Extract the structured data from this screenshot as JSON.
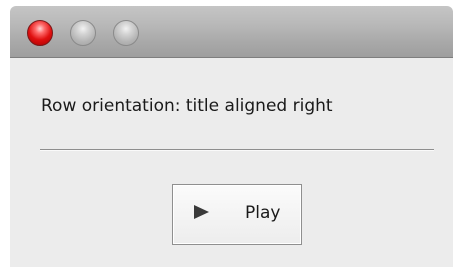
{
  "window": {
    "controls": {
      "close_icon": "close-traffic-light",
      "minimize_icon": "minimize-traffic-light",
      "zoom_icon": "zoom-traffic-light",
      "close_color": "#e01010",
      "inactive_color": "#b4b4b4"
    }
  },
  "content": {
    "heading": "Row orientation: title aligned right",
    "play_button": {
      "icon": "play-icon",
      "label": "Play"
    }
  }
}
